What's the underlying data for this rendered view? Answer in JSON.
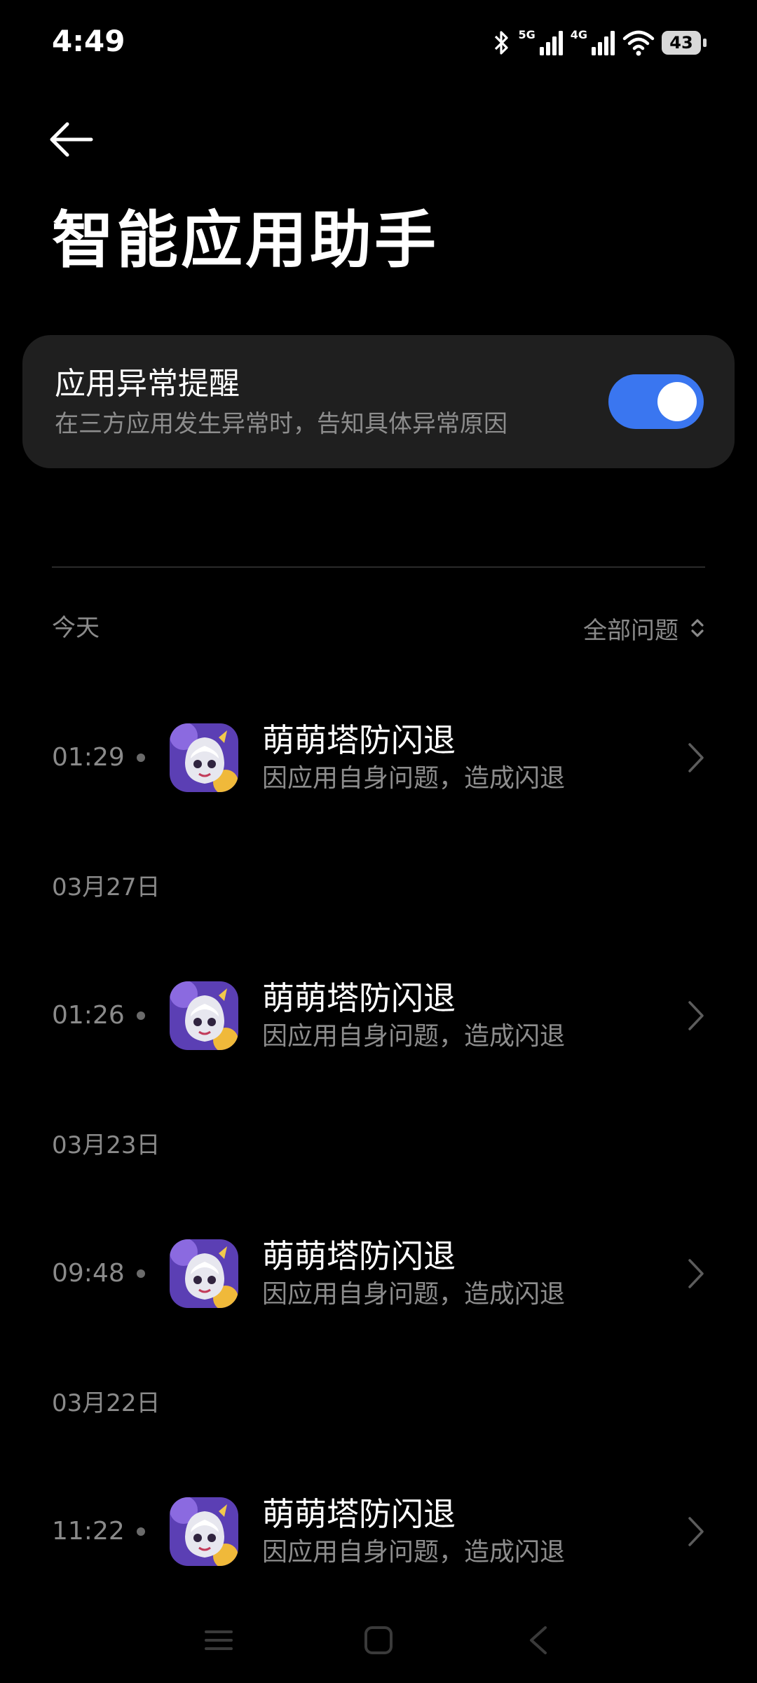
{
  "status_bar": {
    "time": "4:49",
    "network_1": "5G",
    "network_2": "4G",
    "battery_level": "43",
    "icons": [
      "bluetooth-icon",
      "signal-icon",
      "signal-icon",
      "wifi-icon",
      "battery-icon"
    ]
  },
  "header": {
    "back_icon": "back-arrow-icon",
    "title": "智能应用助手"
  },
  "setting": {
    "title": "应用异常提醒",
    "description": "在三方应用发生异常时，告知具体异常原因",
    "toggle_on": true,
    "toggle_color": "#3a76f0"
  },
  "list_header": {
    "section_label": "今天",
    "filter_label": "全部问题",
    "filter_icon": "sort-updown-icon"
  },
  "groups": [
    {
      "date": "今天",
      "events": [
        {
          "time": "01:29",
          "app_name": "萌萌塔防闪退",
          "reason": "因应用自身问题，造成闪退"
        }
      ]
    },
    {
      "date": "03月27日",
      "events": [
        {
          "time": "01:26",
          "app_name": "萌萌塔防闪退",
          "reason": "因应用自身问题，造成闪退"
        }
      ]
    },
    {
      "date": "03月23日",
      "events": [
        {
          "time": "09:48",
          "app_name": "萌萌塔防闪退",
          "reason": "因应用自身问题，造成闪退"
        }
      ]
    },
    {
      "date": "03月22日",
      "events": [
        {
          "time": "11:22",
          "app_name": "萌萌塔防闪退",
          "reason": "因应用自身问题，造成闪退"
        }
      ]
    }
  ],
  "nav_bar": {
    "icons": [
      "menu-icon",
      "home-square-icon",
      "back-chevron-icon"
    ]
  }
}
